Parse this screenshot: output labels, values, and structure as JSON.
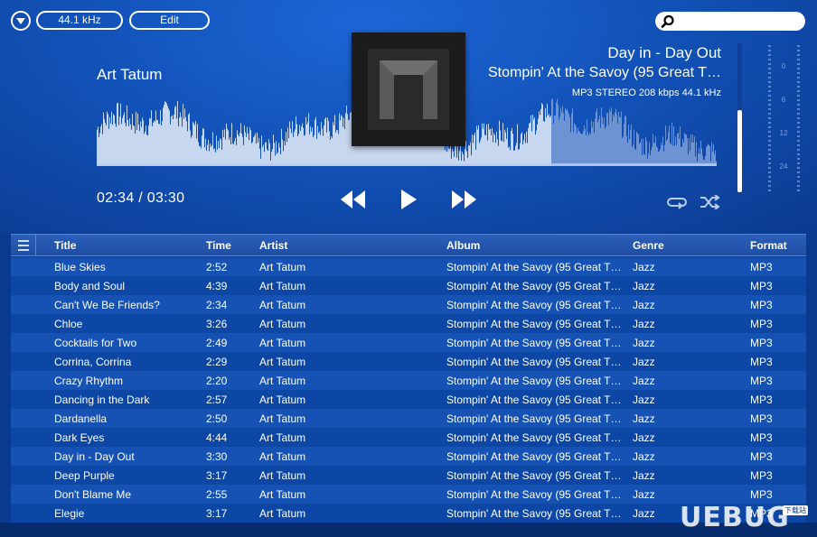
{
  "toolbar": {
    "sample_rate": "44.1 kHz",
    "edit_label": "Edit",
    "search_placeholder": ""
  },
  "now_playing": {
    "artist": "Art Tatum",
    "title": "Day in - Day Out",
    "album": "Stompin' At the Savoy (95 Great T…",
    "audio_info": "MP3 STEREO 208 kbps 44.1 kHz",
    "time": "02:34 / 03:30",
    "progress": 0.733,
    "volume": 0.55
  },
  "meter": {
    "labels": [
      "0",
      "6",
      "12",
      "24"
    ]
  },
  "table": {
    "columns": [
      "Title",
      "Time",
      "Artist",
      "Album",
      "Genre",
      "Format"
    ],
    "rows": [
      [
        "Blue Skies",
        "2:52",
        "Art Tatum",
        "Stompin' At the Savoy (95 Great T…",
        "Jazz",
        "MP3"
      ],
      [
        "Body and Soul",
        "4:39",
        "Art Tatum",
        "Stompin' At the Savoy (95 Great T…",
        "Jazz",
        "MP3"
      ],
      [
        "Can't We Be Friends?",
        "2:34",
        "Art Tatum",
        "Stompin' At the Savoy (95 Great T…",
        "Jazz",
        "MP3"
      ],
      [
        "Chloe",
        "3:26",
        "Art Tatum",
        "Stompin' At the Savoy (95 Great T…",
        "Jazz",
        "MP3"
      ],
      [
        "Cocktails for Two",
        "2:49",
        "Art Tatum",
        "Stompin' At the Savoy (95 Great T…",
        "Jazz",
        "MP3"
      ],
      [
        "Corrina, Corrina",
        "2:29",
        "Art Tatum",
        "Stompin' At the Savoy (95 Great T…",
        "Jazz",
        "MP3"
      ],
      [
        "Crazy Rhythm",
        "2:20",
        "Art Tatum",
        "Stompin' At the Savoy (95 Great T…",
        "Jazz",
        "MP3"
      ],
      [
        "Dancing in the Dark",
        "2:57",
        "Art Tatum",
        "Stompin' At the Savoy (95 Great T…",
        "Jazz",
        "MP3"
      ],
      [
        "Dardanella",
        "2:50",
        "Art Tatum",
        "Stompin' At the Savoy (95 Great T…",
        "Jazz",
        "MP3"
      ],
      [
        "Dark Eyes",
        "4:44",
        "Art Tatum",
        "Stompin' At the Savoy (95 Great T…",
        "Jazz",
        "MP3"
      ],
      [
        "Day in - Day Out",
        "3:30",
        "Art Tatum",
        "Stompin' At the Savoy (95 Great T…",
        "Jazz",
        "MP3"
      ],
      [
        "Deep Purple",
        "3:17",
        "Art Tatum",
        "Stompin' At the Savoy (95 Great T…",
        "Jazz",
        "MP3"
      ],
      [
        "Don't Blame Me",
        "2:55",
        "Art Tatum",
        "Stompin' At the Savoy (95 Great T…",
        "Jazz",
        "MP3"
      ],
      [
        "Elegie",
        "3:17",
        "Art Tatum",
        "Stompin' At the Savoy (95 Great T…",
        "Jazz",
        "MP3"
      ]
    ]
  },
  "watermark": {
    "text": "UEBUG",
    "sub": "下载站"
  },
  "icons": {
    "menu": "dropdown-icon",
    "search": "search-icon",
    "rewind": "rewind-icon",
    "play": "play-icon",
    "forward": "fast-forward-icon",
    "repeat": "repeat-icon",
    "shuffle": "shuffle-icon",
    "columns": "list-menu-icon"
  },
  "colors": {
    "background": "#1252b8",
    "played_wave": "#c7d7ef",
    "unplayed_wave": "#6d93d3",
    "row_odd": "#1552b3",
    "row_even": "#0d47a6"
  }
}
